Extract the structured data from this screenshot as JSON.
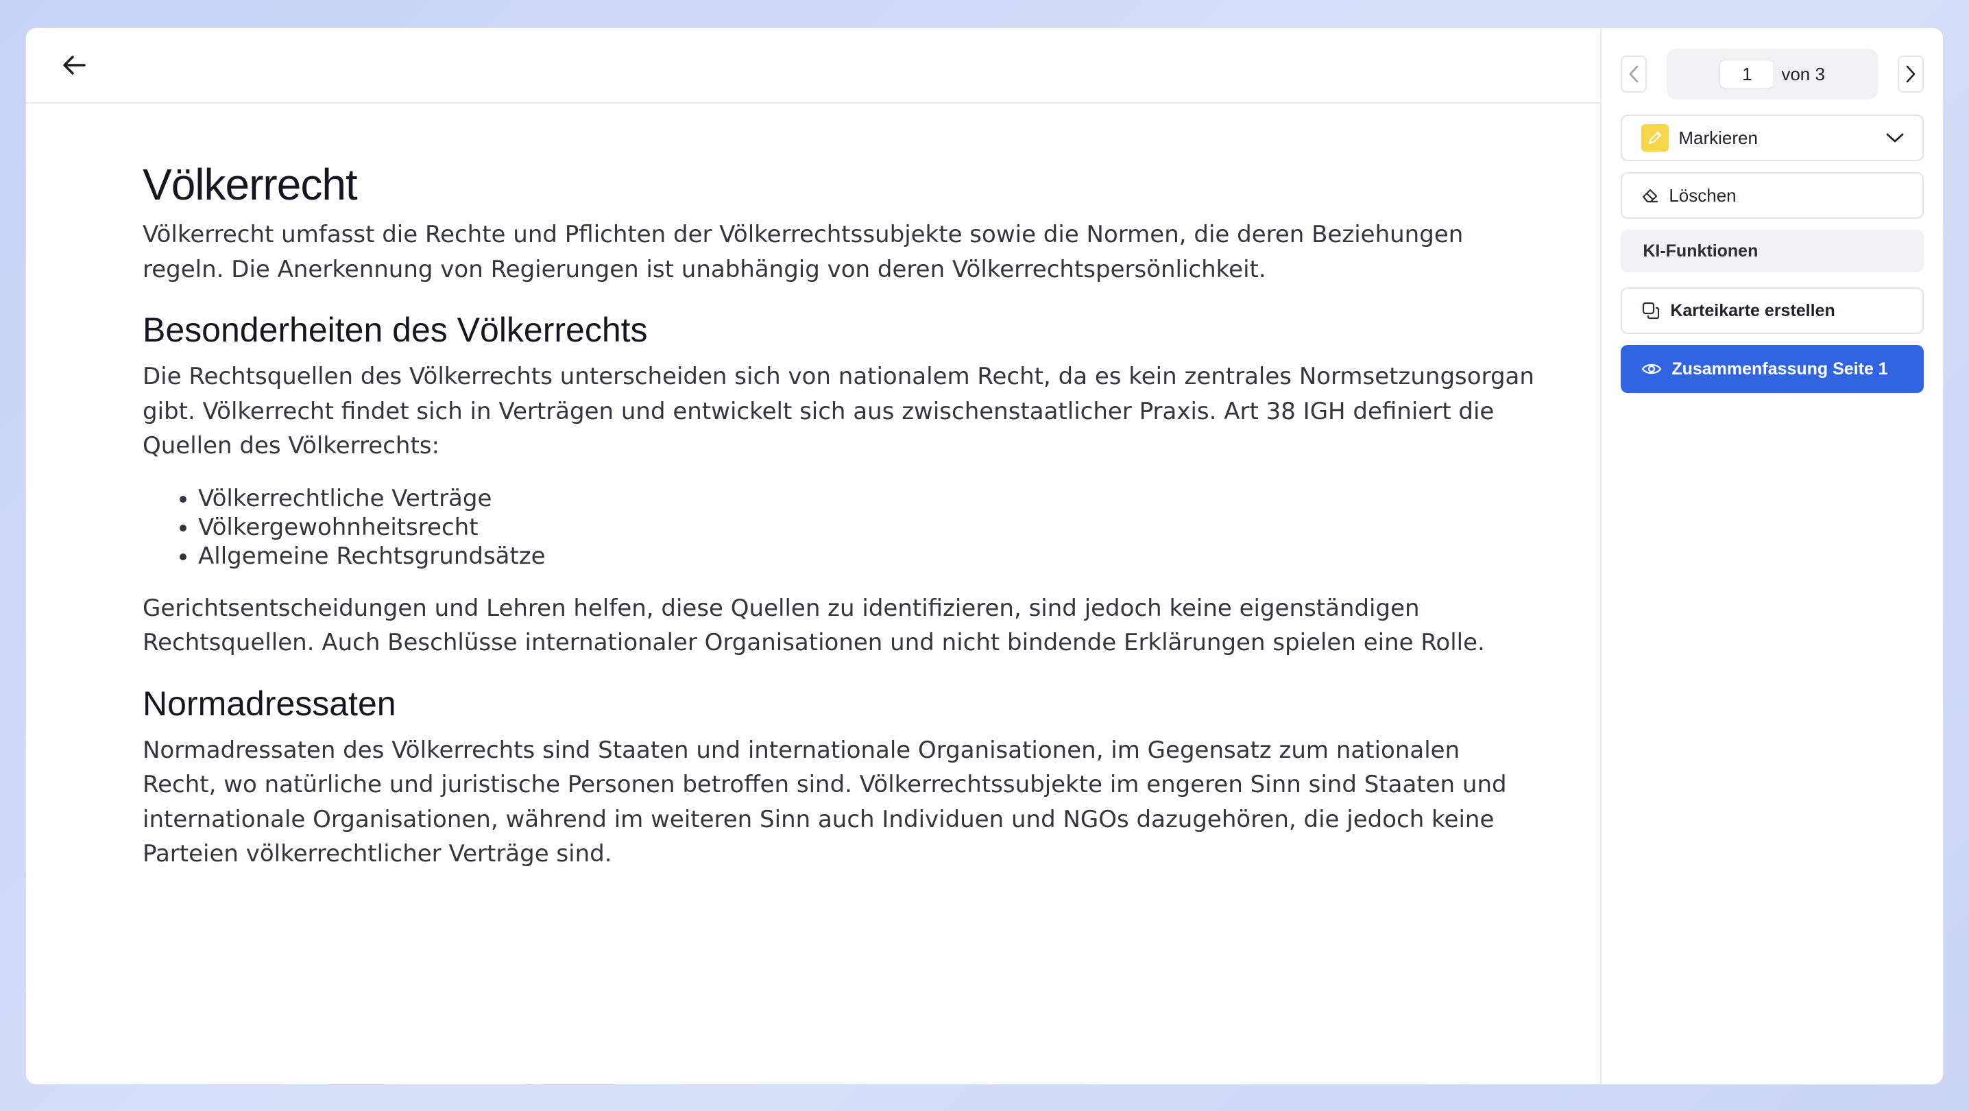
{
  "document": {
    "title": "Völkerrecht",
    "intro": "Völkerrecht umfasst die Rechte und Pflichten der Völkerrechtssubjekte sowie die Normen, die deren Beziehungen regeln. Die Anerkennung von Regierungen ist unabhängig von deren Völkerrechtspersönlichkeit.",
    "section1": {
      "heading": "Besonderheiten des Völkerrechts",
      "paragraph": "Die Rechtsquellen des Völkerrechts unterscheiden sich von nationalem Recht, da es kein zentrales Normsetzungsorgan gibt. Völkerrecht findet sich in Verträgen und entwickelt sich aus zwischenstaatlicher Praxis. Art 38 IGH definiert die Quellen des Völkerrechts:",
      "list": [
        "Völkerrechtliche Verträge",
        "Völkergewohnheitsrecht",
        "Allgemeine Rechtsgrundsätze"
      ],
      "paragraph2": "Gerichtsentscheidungen und Lehren helfen, diese Quellen zu identifizieren, sind jedoch keine eigenständigen Rechtsquellen. Auch Beschlüsse internationaler Organisationen und nicht bindende Erklärungen spielen eine Rolle."
    },
    "section2": {
      "heading": "Normadressaten",
      "paragraph": "Normadressaten des Völkerrechts sind Staaten und internationale Organisationen, im Gegensatz zum nationalen Recht, wo natürliche und juristische Personen betroffen sind. Völkerrechtssubjekte im engeren Sinn sind Staaten und internationale Organisationen, während im weiteren Sinn auch Individuen und NGOs dazugehören, die jedoch keine Parteien völkerrechtlicher Verträge sind."
    }
  },
  "sidebar": {
    "pager": {
      "current_page": "1",
      "of_label": "von 3"
    },
    "mark_label": "Markieren",
    "delete_label": "Löschen",
    "ai_header": "KI-Funktionen",
    "flashcard_label": "Karteikarte erstellen",
    "summary_label": "Zusammenfassung Seite 1"
  },
  "colors": {
    "accent": "#3065df",
    "highlight": "#f5d54a",
    "page_bg": "#c6d3f5"
  },
  "icons": {
    "back": "arrow-left-icon",
    "prev": "chevron-left-icon",
    "next": "chevron-right-icon",
    "mark": "pencil-icon",
    "dropdown": "chevron-down-icon",
    "delete": "eraser-icon",
    "flashcard": "copy-icon",
    "summary": "eye-icon"
  }
}
